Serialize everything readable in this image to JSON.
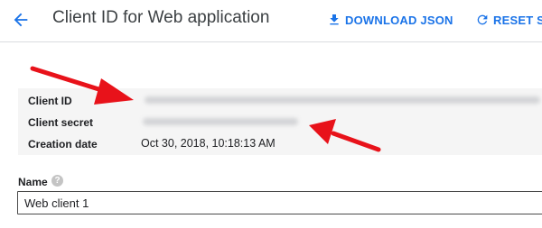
{
  "header": {
    "title": "Client ID for Web application",
    "download_label": "DOWNLOAD JSON",
    "reset_label": "RESET SE"
  },
  "details": {
    "rows": [
      {
        "label": "Client ID",
        "value": ""
      },
      {
        "label": "Client secret",
        "value": ""
      },
      {
        "label": "Creation date",
        "value": "Oct 30, 2018, 10:18:13 AM"
      }
    ]
  },
  "name_field": {
    "label": "Name",
    "value": "Web client 1"
  },
  "icons": [
    "back-arrow-icon",
    "download-icon",
    "refresh-icon",
    "help-icon"
  ],
  "colors": {
    "accent": "#1a73e8",
    "annotation_arrow": "#e8121a"
  }
}
